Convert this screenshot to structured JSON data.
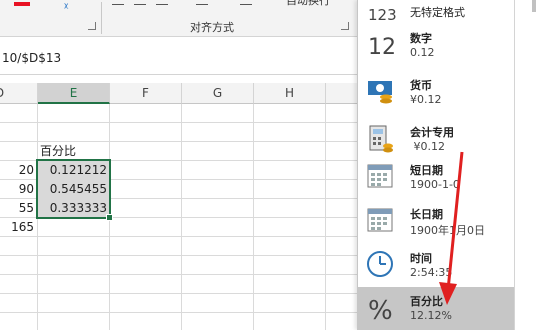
{
  "ribbon": {
    "group_label": "对齐方式",
    "wrap_text_fragment": "自动换行"
  },
  "formula_bar": {
    "visible_formula": "10/$D$13"
  },
  "columns": [
    "D",
    "E",
    "F",
    "G",
    "H"
  ],
  "cells": {
    "header_label": "百分比",
    "d_values": [
      "20",
      "90",
      "55",
      "165"
    ],
    "e_values": [
      "0.121212",
      "0.545455",
      "0.333333"
    ]
  },
  "format_menu": {
    "items": [
      {
        "icon": "general-123-icon",
        "name": "无特定格式",
        "sample": ""
      },
      {
        "icon": "number-12-icon",
        "name": "数字",
        "sample": "0.12"
      },
      {
        "icon": "currency-icon",
        "name": "货币",
        "sample": "¥0.12"
      },
      {
        "icon": "accounting-icon",
        "name": "会计专用",
        "sample": " ¥0.12"
      },
      {
        "icon": "short-date-icon",
        "name": "短日期",
        "sample": "1900-1-0"
      },
      {
        "icon": "long-date-icon",
        "name": "长日期",
        "sample": "1900年1月0日"
      },
      {
        "icon": "clock-icon",
        "name": "时间",
        "sample": "2:54:35"
      },
      {
        "icon": "percent-icon",
        "name": "百分比",
        "sample": "12.12%"
      }
    ],
    "highlight_color": "#c6c6c6"
  },
  "colors": {
    "excel_green": "#217346",
    "annotation_red": "#e02020",
    "selection_shade": "#d9d9d9"
  }
}
